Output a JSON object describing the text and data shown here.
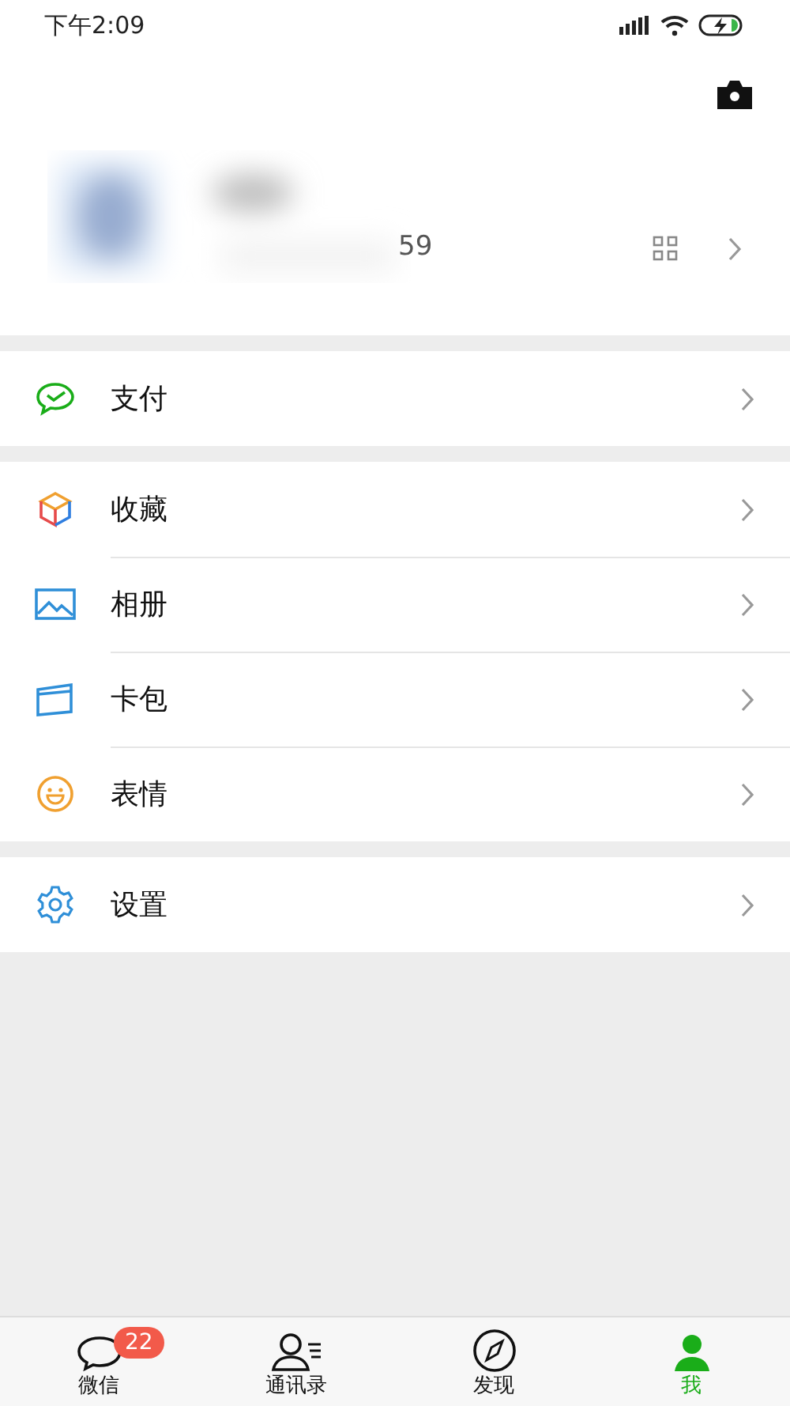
{
  "status_bar": {
    "time": "下午2:09"
  },
  "profile": {
    "id_fragment": "59"
  },
  "menu_groups": [
    {
      "items": [
        {
          "label": "支付"
        }
      ]
    },
    {
      "items": [
        {
          "label": "收藏"
        },
        {
          "label": "相册"
        },
        {
          "label": "卡包"
        },
        {
          "label": "表情"
        }
      ]
    },
    {
      "items": [
        {
          "label": "设置"
        }
      ]
    }
  ],
  "tab_bar": [
    {
      "label": "微信",
      "badge": "22",
      "selected": false
    },
    {
      "label": "通讯录",
      "selected": false
    },
    {
      "label": "发现",
      "selected": false
    },
    {
      "label": "我",
      "selected": true
    }
  ]
}
